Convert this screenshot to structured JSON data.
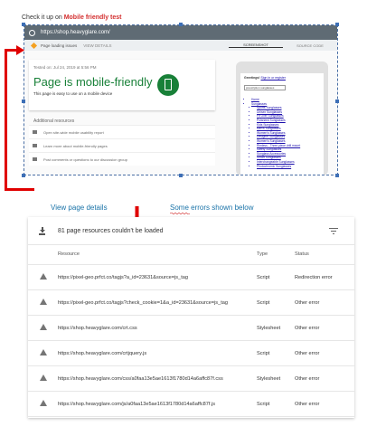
{
  "caption": {
    "prefix": "Check it up on ",
    "highlight": "Mobile friendly  test"
  },
  "screenshot": {
    "url": "https://shop.heavyglare.com/",
    "subbar_status": "Page loading issues",
    "subbar_link": "VIEW DETAILS",
    "tabs": [
      "SCREENSHOT",
      "SOURCE CODE"
    ],
    "tested_on": "Tested on: Jul 24, 2019 at 5:56 PM",
    "result_title": "Page is mobile-friendly",
    "result_sub": "This page is easy to use on a mobile device",
    "resources_title": "Additional resources",
    "resources": [
      "Open site-wide mobile usability report",
      "Learn more about mobile-friendly pages",
      "Post comments or questions to our discussion group"
    ],
    "phone": {
      "greeting": "Greetings!",
      "greeting_links": "Sign in or register",
      "search_placeholder": "prescription sunglasses",
      "links": [
        "Home",
        "Sunglasses",
        "Sports Sunglasses",
        "Unisex Sunglasses",
        "Fit Over Sunglasses",
        "Polarized Sunglasses",
        "Kids Sunglasses",
        "Men's Sunglasses",
        "Women's Sunglasses",
        "Designer Sunglasses",
        "Women's Sunglasses",
        "Rimless - Three piece drill mount",
        "Safety Sunglasses",
        "Sunglass Accessories",
        "Smart Sunglasses",
        "Interchangeable Sunglasses",
        "Photochromic Sunglasses"
      ]
    }
  },
  "annotations": {
    "view_details": "View page details",
    "errors_below": "Some errors shown below"
  },
  "panel": {
    "header": "81 page resources couldn't be loaded",
    "columns": [
      "Resource",
      "Type",
      "Status"
    ],
    "rows": [
      {
        "url": "https://pixel-geo.prfct.co/tagjs?a_id=23631&source=js_tag",
        "type": "Script",
        "status": "Redirection error"
      },
      {
        "url": "https://pixel-geo.prfct.co/tagjs?check_cookie=1&a_id=23631&source=js_tag",
        "type": "Script",
        "status": "Other error"
      },
      {
        "url": "https://shop.heavyglare.com/crt.css",
        "type": "Stylesheet",
        "status": "Other error"
      },
      {
        "url": "https://shop.heavyglare.com/crtjquery.js",
        "type": "Script",
        "status": "Other error"
      },
      {
        "url": "https://shop.heavyglare.com/css/a0faa13e5ae1613f1780d14a6affc87f.css",
        "type": "Stylesheet",
        "status": "Other error"
      },
      {
        "url": "https://shop.heavyglare.com/js/a0faa13e5ae1613f1780d14a6affc87f.js",
        "type": "Script",
        "status": "Other error"
      }
    ]
  },
  "colors": {
    "success": "#188038",
    "accent_red": "#e00000",
    "link_blue": "#1a73a8"
  }
}
